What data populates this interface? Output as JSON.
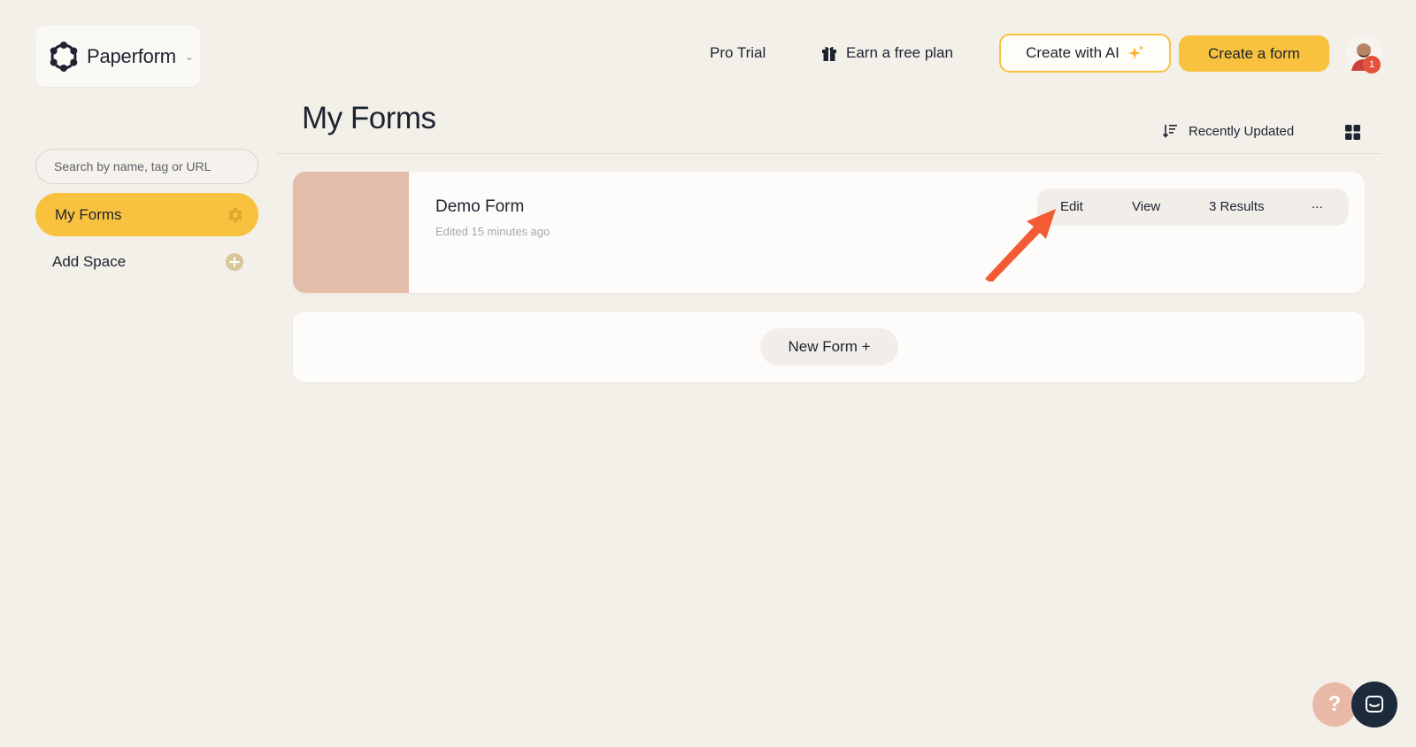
{
  "brand": {
    "name": "Paperform"
  },
  "header": {
    "pro_trial": "Pro Trial",
    "earn_free_plan": "Earn a free plan",
    "create_with_ai": "Create with AI",
    "create_form": "Create a form",
    "avatar_badge": "1"
  },
  "sidebar": {
    "search_placeholder": "Search by name, tag or URL",
    "items": [
      {
        "label": "My Forms",
        "active": true
      },
      {
        "label": "Add Space",
        "active": false
      }
    ]
  },
  "main": {
    "title": "My Forms",
    "sort_label": "Recently Updated",
    "forms": [
      {
        "name": "Demo Form",
        "meta": "Edited 15 minutes ago",
        "actions": {
          "edit": "Edit",
          "view": "View",
          "results": "3 Results",
          "more": "..."
        }
      }
    ],
    "new_form_label": "New Form +"
  },
  "colors": {
    "background": "#f3f0ea",
    "accent": "#f8c23e",
    "thumbnail": "#e3bda9",
    "annotation_arrow": "#f45a34",
    "chat_button": "#1c2a3c"
  }
}
